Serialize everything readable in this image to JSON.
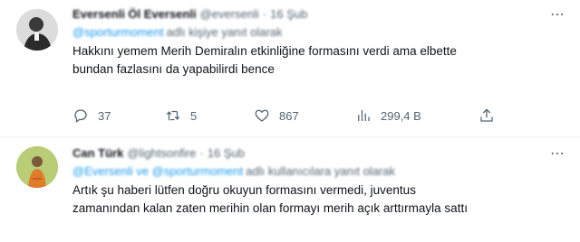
{
  "tweets": [
    {
      "name": "Eversenli Öl Eversenli",
      "handle": "@eversenli",
      "time": "16 Şub",
      "reply_mention": "@sporturmoment",
      "reply_text": "adlı kişiye yanıt olarak",
      "text": "Hakkını yemem Merih Demiralın etkinliğine formasını verdi ama elbette\nbundan fazlasını da yapabilirdi bence",
      "stats": {
        "replies": "37",
        "retweets": "5",
        "likes": "867",
        "views": "299,4 B"
      }
    },
    {
      "name": "Can Türk",
      "handle": "@lightsonfire",
      "time": "16 Şub",
      "reply_mention": "@Eversenli ve @sporturmoment",
      "reply_text": "adlı kullanıcılara yanıt olarak",
      "text": "Artık şu haberi lütfen doğru okuyun formasını vermedi, juventus\nzamanından kalan zaten merihin olan formayı merih açık arttırmayla sattı"
    }
  ],
  "icons": {
    "more": "more-horizontal-icon",
    "reply": "reply-icon",
    "retweet": "retweet-icon",
    "like": "heart-icon",
    "views": "views-chart-icon",
    "share": "share-icon"
  },
  "colors": {
    "link": "#1d9bf0",
    "secondary": "#536471",
    "text": "#0f1419"
  }
}
